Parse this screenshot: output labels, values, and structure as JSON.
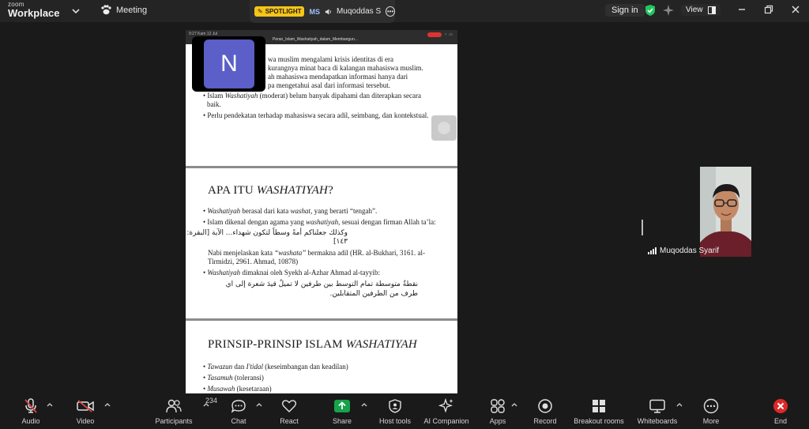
{
  "app": {
    "logo_line1": "zoom",
    "logo_line2": "Workplace"
  },
  "topbar": {
    "meeting_label": "Meeting",
    "spotlight_badge": "SPOTLIGHT",
    "speaker_initials": "MS",
    "speaker_name": "Muqoddas S",
    "signin_label": "Sign in",
    "view_label": "View"
  },
  "share": {
    "bar_left": "9:27  Kam 12 Jul",
    "file_title": "Peran_Islam_Washatiyah_dalam_Membangun...",
    "slide1": {
      "lines": [
        "wa muslim mengalami krisis identitas di era",
        "kurangnya minat baca di kalangan mahasiswa muslim.",
        "ah mahasiswa mendapatkan informasi hanya dari",
        "pa mengetahui asal dari informasi tersebut."
      ],
      "bullet2_pre": "Islam ",
      "bullet2_em": "Washatiyah",
      "bullet2_post": " (moderat) belum banyak dipahami dan diterapkan secara baik.",
      "bullet3": "Perlu pendekatan terhadap mahasiswa secara adil, seimbang, dan kontekstual."
    },
    "slide2": {
      "title_pre": "APA ITU ",
      "title_em": "WASHATIYAH",
      "title_post": "?",
      "b1_em": "Washatiyah",
      "b1_mid": " berasal dari kata ",
      "b1_em2": "washat",
      "b1_post": ", yang berarti “tengah”.",
      "b2_pre": "Islam dikenal dengan agama yang ",
      "b2_em": "washatiyah",
      "b2_post": ", sesuai dengan firman Allah ta’la:",
      "arabic1": "وكذلك جعلناكم أمةً وسطاً لتكون شهداء... الآية [البقرة: ١٤٣]",
      "nabi_pre": "Nabi menjelaskan kata ",
      "nabi_em": "“washata”",
      "nabi_post": " bermakna adil (HR. al-Bukhari, 3161. al-Tirmidzi, 2961. Ahmad, 10878)",
      "b3_em": "Washatiyah",
      "b3_post": " dimaknai oleh Syekh al-Azhar Ahmad al-tayyib:",
      "arabic2": "نقطةٌ متوسطة تمام التوسط بين طرفين لا تميلُ قيدَ شعرة إلى اي طرف من الطرفين المتقابلين."
    },
    "slide3": {
      "title_pre": "PRINSIP-PRINSIP ISLAM ",
      "title_em": "WASHATIYAH",
      "b1_em": "Tawazun",
      "b1_mid": " dan ",
      "b1_em2": "I'tidal",
      "b1_post": " (keseimbangan dan keadilan)",
      "b2_em": "Tasamuh",
      "b2_post": " (toleransi)",
      "b3_em": "Musawah",
      "b3_post": " (kesetaraan)"
    }
  },
  "avatar_tile": {
    "initial": "N",
    "color": "#5b5fc7"
  },
  "participant": {
    "name": "Muqoddas Syarif"
  },
  "toolbar": {
    "audio": "Audio",
    "video": "Video",
    "participants": "Participants",
    "participants_count": "234",
    "chat": "Chat",
    "react": "React",
    "share": "Share",
    "host_tools": "Host tools",
    "ai_companion": "AI Companion",
    "apps": "Apps",
    "record": "Record",
    "breakout": "Breakout rooms",
    "whiteboards": "Whiteboards",
    "more": "More",
    "end": "End"
  },
  "colors": {
    "share_green": "#16a34a",
    "end_red": "#e02828",
    "spotlight": "#f5c518",
    "avatar": "#5b5fc7"
  }
}
